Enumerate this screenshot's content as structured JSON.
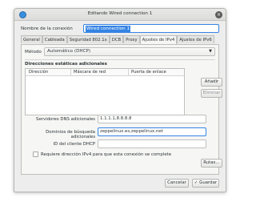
{
  "window": {
    "title": "Editando Wired connection 1",
    "close_glyph": "×"
  },
  "connection_name": {
    "label": "Nombre de la conexión",
    "value": "Wired connection 1"
  },
  "tabs": [
    {
      "label": "General"
    },
    {
      "label": "Cableada"
    },
    {
      "label": "Seguridad 802.1x"
    },
    {
      "label": "DCB"
    },
    {
      "label": "Proxy"
    },
    {
      "label": "Ajustes de IPv4"
    },
    {
      "label": "Ajustes de IPv6"
    }
  ],
  "active_tab": "Ajustes de IPv4",
  "ipv4": {
    "method_label": "Método",
    "method_value": "Automático (DHCP)",
    "static_title": "Direcciones estáticas adicionales",
    "table_columns": [
      "Dirección",
      "Máscara de red",
      "Puerta de enlace"
    ],
    "add_button": "Añadir",
    "remove_button": "Eliminar",
    "dns_label": "Servidores DNS adicionales",
    "dns_value": "1.1.1.1,8.8.8.8",
    "search_label": "Dominios de búsqueda adicionales",
    "search_value": "zeppelinux.es,zeppelinux.net",
    "dhcp_id_label": "ID del cliente DHCP",
    "dhcp_id_value": "",
    "require_ipv4_label": "Requiere dirección IPv4 para que esta conexión se complete",
    "require_ipv4_checked": false,
    "routes_button": "Rutas…"
  },
  "footer": {
    "cancel": "Cancelar",
    "save": "Guardar",
    "save_icon": "check-icon"
  },
  "colors": {
    "accent": "#3584e4",
    "window_bg": "#ededed"
  }
}
